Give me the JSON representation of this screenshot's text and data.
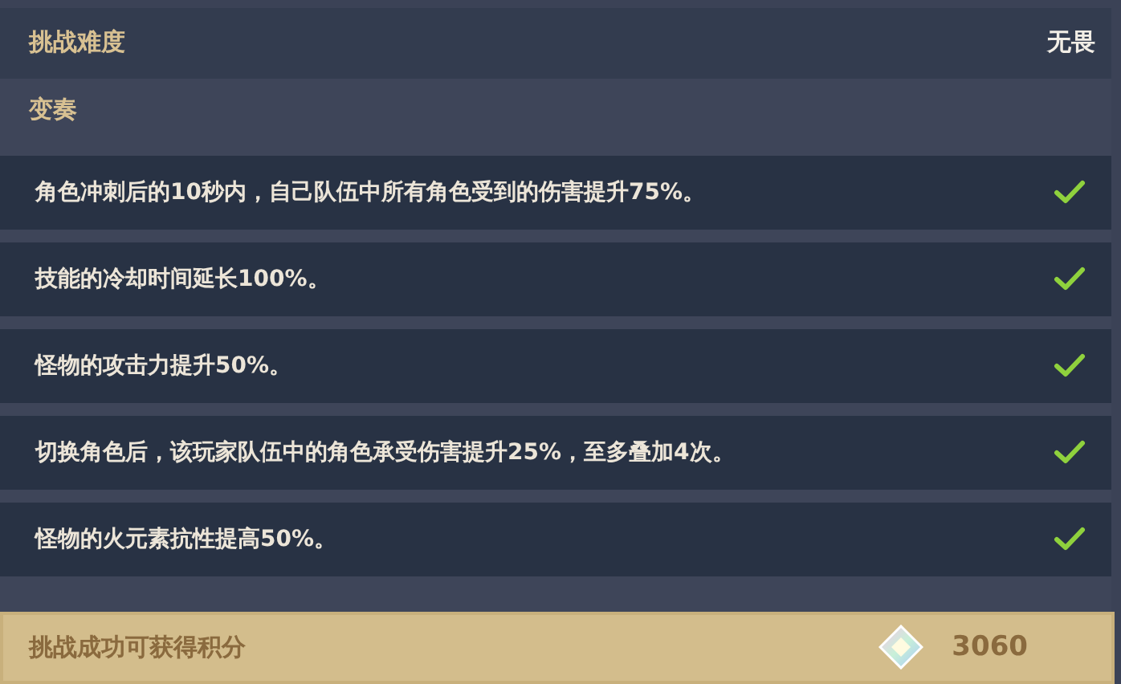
{
  "difficulty": {
    "label": "挑战难度",
    "value": "无畏"
  },
  "variations": {
    "title": "变奏",
    "items": [
      {
        "text": "角色冲刺后的10秒内，自己队伍中所有角色受到的伤害提升75%。",
        "checked": true
      },
      {
        "text": "技能的冷却时间延长100%。",
        "checked": true
      },
      {
        "text": "怪物的攻击力提升50%。",
        "checked": true
      },
      {
        "text": "切换角色后，该玩家队伍中的角色承受伤害提升25%，至多叠加4次。",
        "checked": true
      },
      {
        "text": "怪物的火元素抗性提高50%。",
        "checked": true
      }
    ]
  },
  "reward": {
    "label": "挑战成功可获得积分",
    "points": "3060"
  }
}
